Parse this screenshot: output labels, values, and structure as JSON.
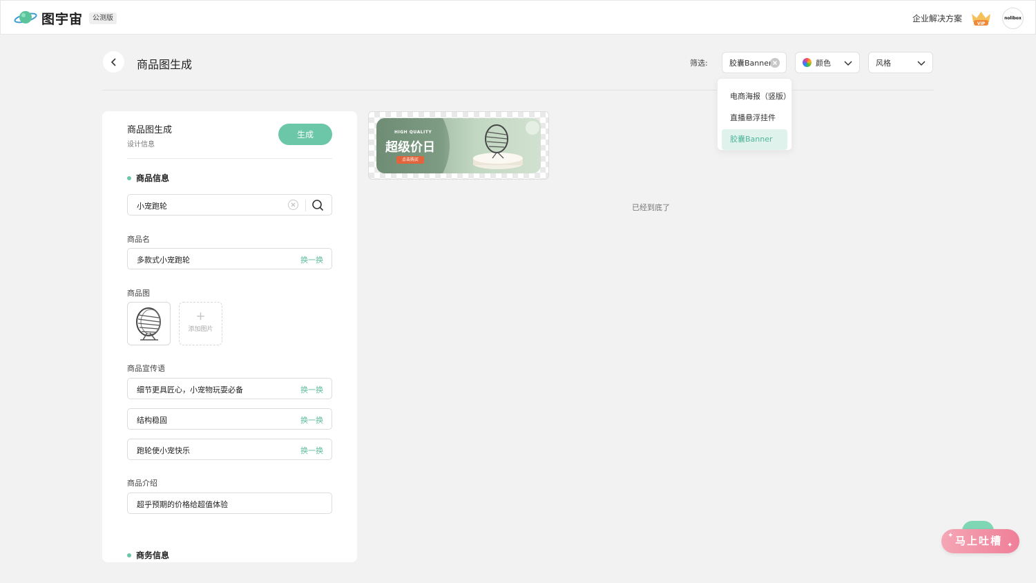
{
  "app": {
    "name": "图宇宙",
    "beta_tag": "公测版",
    "enterprise_link": "企业解决方案",
    "vip_label": "VIP",
    "avatar_text": "nolibox"
  },
  "header": {
    "title": "商品图生成",
    "filter_label": "筛选:",
    "filters": {
      "type": "胶囊Banner",
      "color": "颜色",
      "style": "风格"
    }
  },
  "dropdown": {
    "items": [
      "电商海报（竖版）",
      "直播悬浮挂件",
      "胶囊Banner"
    ],
    "active": "胶囊Banner"
  },
  "panel": {
    "title": "商品图生成",
    "subtitle": "设计信息",
    "generate_label": "生成",
    "product_section": "商品信息",
    "search_value": "小宠跑轮",
    "name_label": "商品名",
    "name_value": "多款式小宠跑轮",
    "swap_label": "换一换",
    "image_label": "商品图",
    "add_image_label": "添加图片",
    "slogan_label": "商品宣传语",
    "slogans": [
      "细节更具匠心，小宠物玩耍必备",
      "结构稳固",
      "跑轮使小宠快乐"
    ],
    "intro_label": "商品介绍",
    "intro_value": "超乎预期的价格给超值体验",
    "business_section": "商务信息"
  },
  "result": {
    "banner_tag": "HIGH QUALITY",
    "banner_title": "超级价日",
    "banner_cta": "点击购买",
    "end_text": "已经到底了"
  },
  "feedback": {
    "label": "马上吐槽"
  },
  "colors": {
    "accent": "#6cc6a8",
    "accent_text": "#5bbd9c",
    "active_bg": "#dff3ec",
    "feedback": "#ef7f98"
  }
}
